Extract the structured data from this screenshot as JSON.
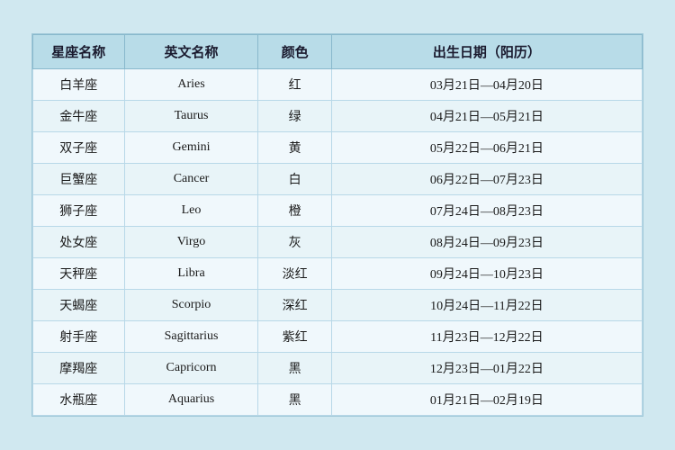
{
  "table": {
    "headers": {
      "chinese_name": "星座名称",
      "english_name": "英文名称",
      "color": "颜色",
      "date_range": "出生日期（阳历）"
    },
    "rows": [
      {
        "chinese": "白羊座",
        "english": "Aries",
        "color": "红",
        "date": "03月21日—04月20日"
      },
      {
        "chinese": "金牛座",
        "english": "Taurus",
        "color": "绿",
        "date": "04月21日—05月21日"
      },
      {
        "chinese": "双子座",
        "english": "Gemini",
        "color": "黄",
        "date": "05月22日—06月21日"
      },
      {
        "chinese": "巨蟹座",
        "english": "Cancer",
        "color": "白",
        "date": "06月22日—07月23日"
      },
      {
        "chinese": "狮子座",
        "english": "Leo",
        "color": "橙",
        "date": "07月24日—08月23日"
      },
      {
        "chinese": "处女座",
        "english": "Virgo",
        "color": "灰",
        "date": "08月24日—09月23日"
      },
      {
        "chinese": "天秤座",
        "english": "Libra",
        "color": "淡红",
        "date": "09月24日—10月23日"
      },
      {
        "chinese": "天蝎座",
        "english": "Scorpio",
        "color": "深红",
        "date": "10月24日—11月22日"
      },
      {
        "chinese": "射手座",
        "english": "Sagittarius",
        "color": "紫红",
        "date": "11月23日—12月22日"
      },
      {
        "chinese": "摩羯座",
        "english": "Capricorn",
        "color": "黑",
        "date": "12月23日—01月22日"
      },
      {
        "chinese": "水瓶座",
        "english": "Aquarius",
        "color": "黑",
        "date": "01月21日—02月19日"
      }
    ]
  }
}
